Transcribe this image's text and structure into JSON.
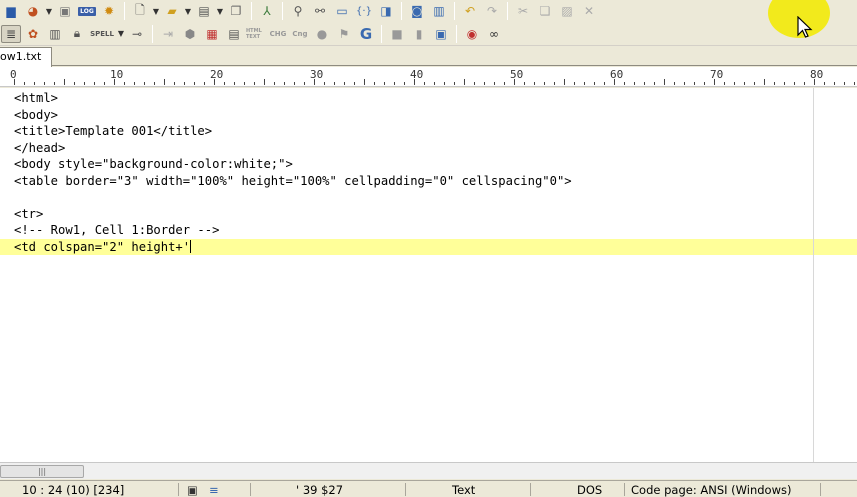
{
  "toolbar1": {
    "log_label": "LOG"
  },
  "toolbar2": {
    "spell_label": "SPELL",
    "html_label": "HTML TEXT",
    "chg_label": "CHG",
    "cng_label": "Cng",
    "g_label": "G"
  },
  "tab": {
    "label": "ow1.txt"
  },
  "ruler": {
    "labels": [
      "0",
      "10",
      "20",
      "30",
      "40",
      "50",
      "60",
      "70",
      "80"
    ]
  },
  "editor": {
    "lines": [
      "<html>",
      "<body>",
      "<title>Template 001</title>",
      "</head>",
      "<body style=\"background-color:white;\">",
      "<table border=\"3\" width=\"100%\" height=\"100%\" cellpadding=\"0\" cellspacing\"0\">",
      "",
      "<tr>",
      "<!-- Row1, Cell 1:Border -->",
      "<td colspan=\"2\" height+'"
    ]
  },
  "statusbar": {
    "position": "10 : 24  (10)  [234]",
    "char_info": "'  39  $27",
    "mode": "Text",
    "line_ending": "DOS",
    "code_page": "Code page: ANSI (Windows)"
  },
  "colors": {
    "current_line": "#ffff99",
    "toolbar_bg": "#ece9d8",
    "cursor_highlight": "#f2ea1c"
  }
}
